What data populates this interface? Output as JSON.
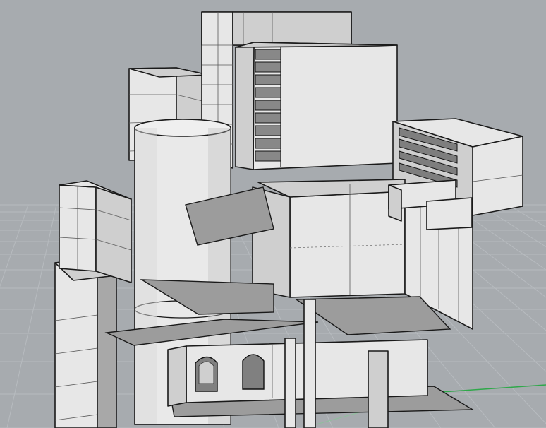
{
  "viewport": {
    "type": "3d-perspective-modeling-view",
    "background": "#a7abaf",
    "grid_color": "#b9bdc1",
    "grid_axis_color": "#2fa84a",
    "model_fill": "#dcdcdc",
    "model_edge": "#1a1a1a"
  }
}
